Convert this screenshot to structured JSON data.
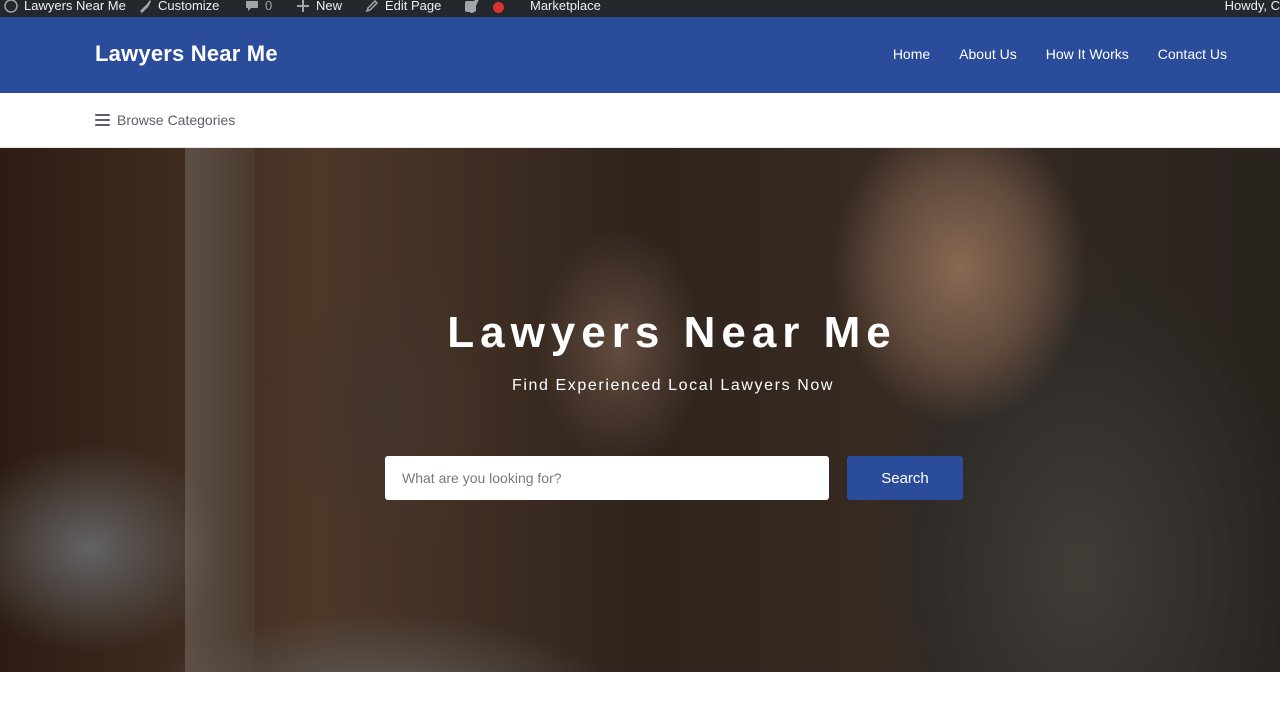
{
  "admin_bar": {
    "site_name": "Lawyers Near Me",
    "customize": "Customize",
    "comments_count": "0",
    "new_label": "New",
    "edit_page": "Edit Page",
    "marketplace": "Marketplace",
    "howdy": "Howdy, C",
    "icons": {
      "site": "wordpress-icon",
      "customize": "paintbrush-icon",
      "comments": "comment-bubble-icon",
      "new": "plus-icon",
      "edit": "pencil-icon",
      "seo": "yoast-seo-icon",
      "status": "red-status-dot-icon"
    }
  },
  "header": {
    "site_title": "Lawyers Near Me",
    "nav": [
      {
        "label": "Home"
      },
      {
        "label": "About Us"
      },
      {
        "label": "How It Works"
      },
      {
        "label": "Contact Us"
      }
    ]
  },
  "browse": {
    "label": "Browse Categories",
    "icon": "hamburger-menu-icon"
  },
  "hero": {
    "title": "Lawyers Near Me",
    "subtitle": "Find Experienced Local Lawyers Now",
    "search_placeholder": "What are you looking for?",
    "search_value": "",
    "search_button": "Search"
  },
  "colors": {
    "brand_blue": "#2b4c9b",
    "admin_bar": "#23282d",
    "status_red": "#dc3232"
  }
}
